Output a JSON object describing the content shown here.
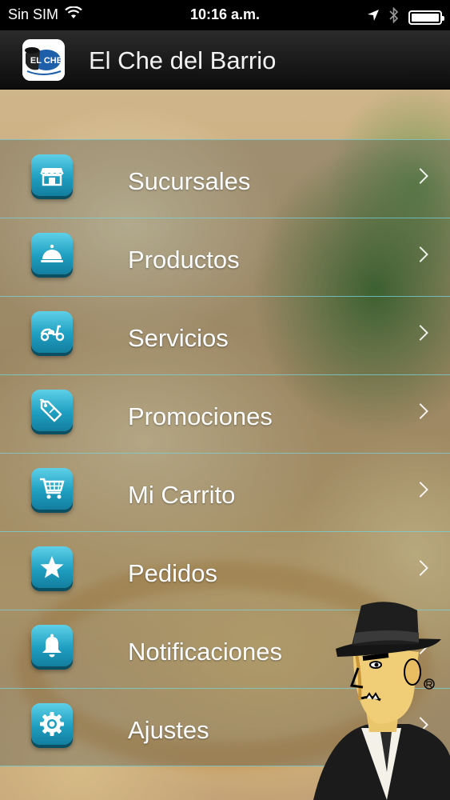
{
  "status_bar": {
    "carrier": "Sin SIM",
    "time": "10:16 a.m."
  },
  "header": {
    "title": "El Che del Barrio",
    "logo_text": "EL CHE"
  },
  "menu": {
    "items": [
      {
        "label": "Sucursales",
        "icon": "storefront-icon"
      },
      {
        "label": "Productos",
        "icon": "serving-cloche-icon"
      },
      {
        "label": "Servicios",
        "icon": "scooter-icon"
      },
      {
        "label": "Promociones",
        "icon": "price-tag-icon"
      },
      {
        "label": "Mi Carrito",
        "icon": "shopping-cart-icon"
      },
      {
        "label": "Pedidos",
        "icon": "star-icon"
      },
      {
        "label": "Notificaciones",
        "icon": "bell-icon"
      },
      {
        "label": "Ajustes",
        "icon": "gear-icon"
      }
    ]
  },
  "colors": {
    "icon_tile": "#1f9fc1",
    "divider": "#78d2d7",
    "nav_bar": "#1a1a1a"
  }
}
